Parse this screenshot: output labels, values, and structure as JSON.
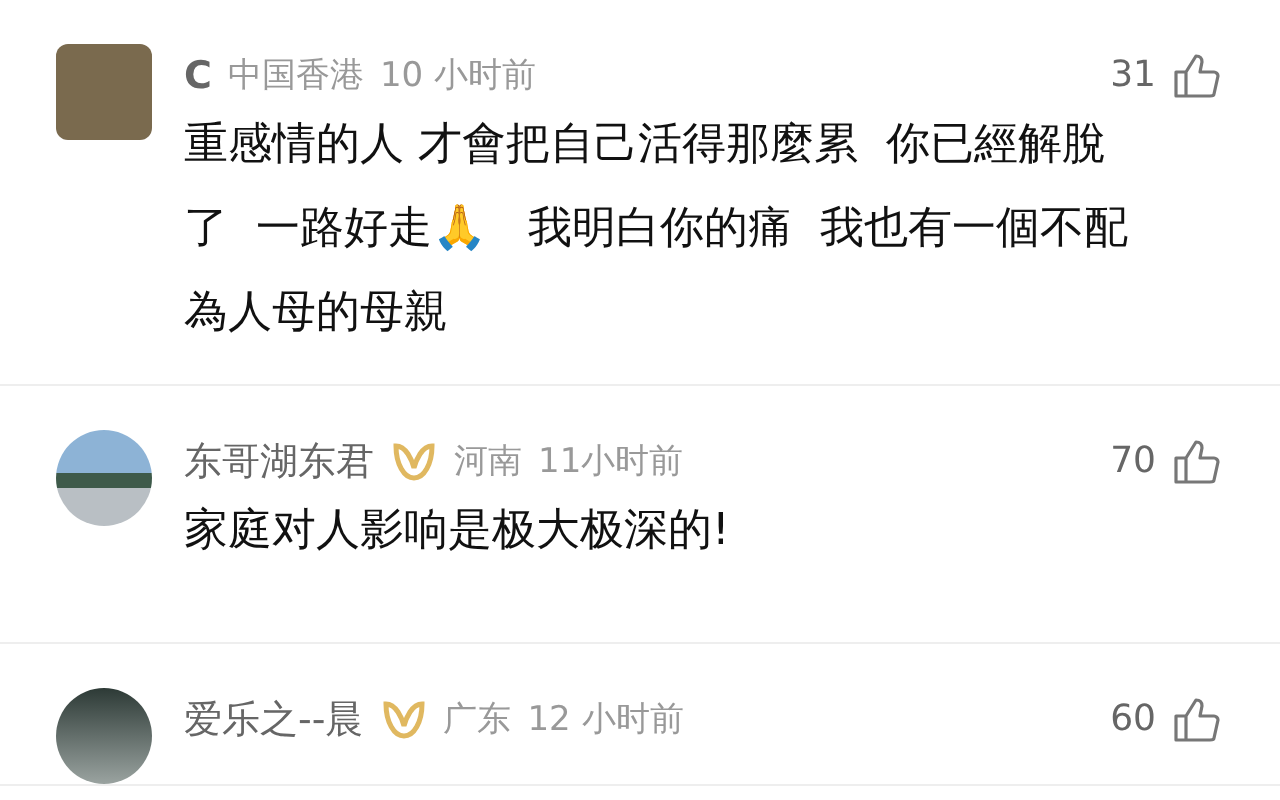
{
  "comments": [
    {
      "kind": "square",
      "user": "C",
      "verified": false,
      "location": "中国香港",
      "time": "10 小时前",
      "likes": "31",
      "text": "重感情的人 才會把自己活得那麼累  你已經解脫了  一路好走🙏   我明白你的痛  我也有一個不配為人母的母親"
    },
    {
      "kind": "circle",
      "user": "东哥湖东君",
      "verified": true,
      "location": "河南",
      "time": "11小时前",
      "likes": "70",
      "text": "家庭对人影响是极大极深的!"
    },
    {
      "kind": "circle",
      "user": "爱乐之--晨",
      "verified": true,
      "location": "广东",
      "time": "12 小时前",
      "likes": "60"
    }
  ]
}
